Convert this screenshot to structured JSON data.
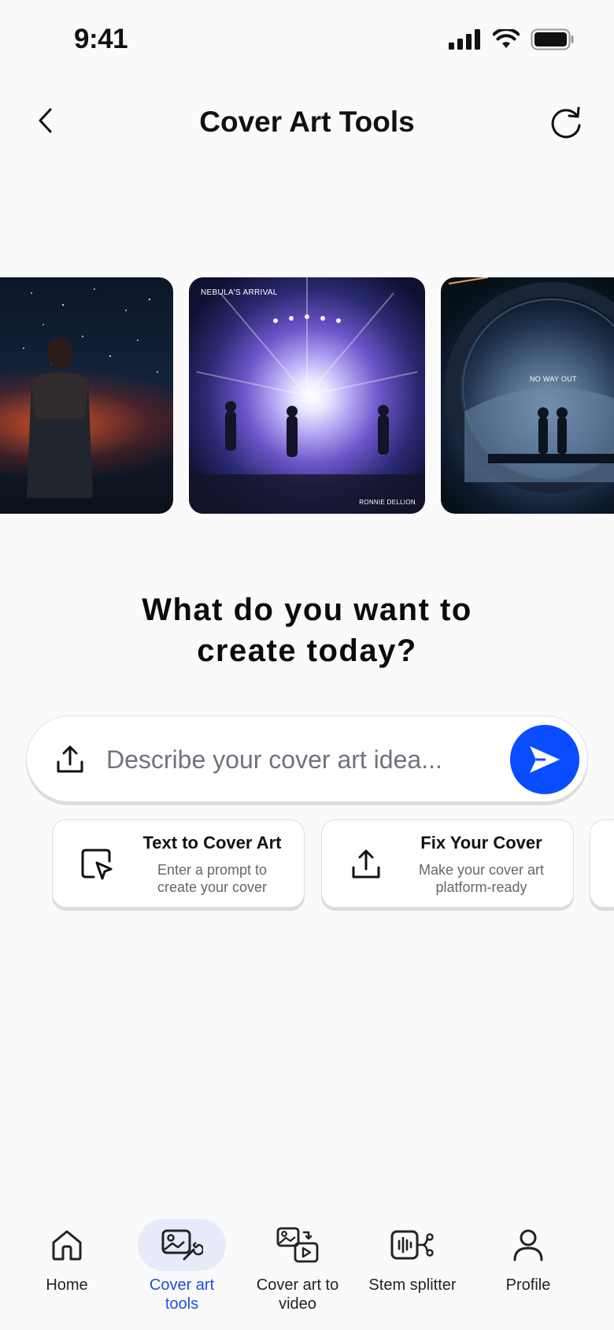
{
  "status_bar": {
    "time": "9:41",
    "icons": [
      "signal-icon",
      "wifi-icon",
      "battery-icon"
    ]
  },
  "header": {
    "title": "Cover Art Tools",
    "back_icon": "chevron-left-icon",
    "refresh_icon": "refresh-icon"
  },
  "carousel": {
    "items": [
      {
        "caption_top": "",
        "caption_bottom": ""
      },
      {
        "caption_top": "NEBULA'S ARRIVAL",
        "caption_bottom": "RONNIE DELLION"
      },
      {
        "caption_top": "NO  WAY  OUT",
        "caption_bottom": ""
      }
    ]
  },
  "prompt": {
    "heading_line1": "What do you want to",
    "heading_line2": "create today?",
    "placeholder": "Describe your cover art idea...",
    "upload_icon": "upload-icon",
    "send_icon": "send-icon",
    "accent": "#0a4dff"
  },
  "tools": [
    {
      "title": "Text to Cover Art",
      "desc_line1": "Enter a prompt to",
      "desc_line2": "create your  cover",
      "icon": "cursor-select-icon"
    },
    {
      "title": "Fix Your Cover",
      "desc_line1": "Make your cover art",
      "desc_line2": "platform-ready",
      "icon": "upload-icon"
    }
  ],
  "nav": {
    "items": [
      {
        "label_line1": "Home",
        "label_line2": "",
        "icon": "home-icon",
        "active": false
      },
      {
        "label_line1": "Cover art",
        "label_line2": "tools",
        "icon": "image-wrench-icon",
        "active": true
      },
      {
        "label_line1": "Cover art to",
        "label_line2": "video",
        "icon": "image-to-video-icon",
        "active": false
      },
      {
        "label_line1": "Stem splitter",
        "label_line2": "",
        "icon": "stem-splitter-icon",
        "active": false
      },
      {
        "label_line1": "Profile",
        "label_line2": "",
        "icon": "person-icon",
        "active": false
      }
    ],
    "active_color": "#1d4ed8"
  }
}
